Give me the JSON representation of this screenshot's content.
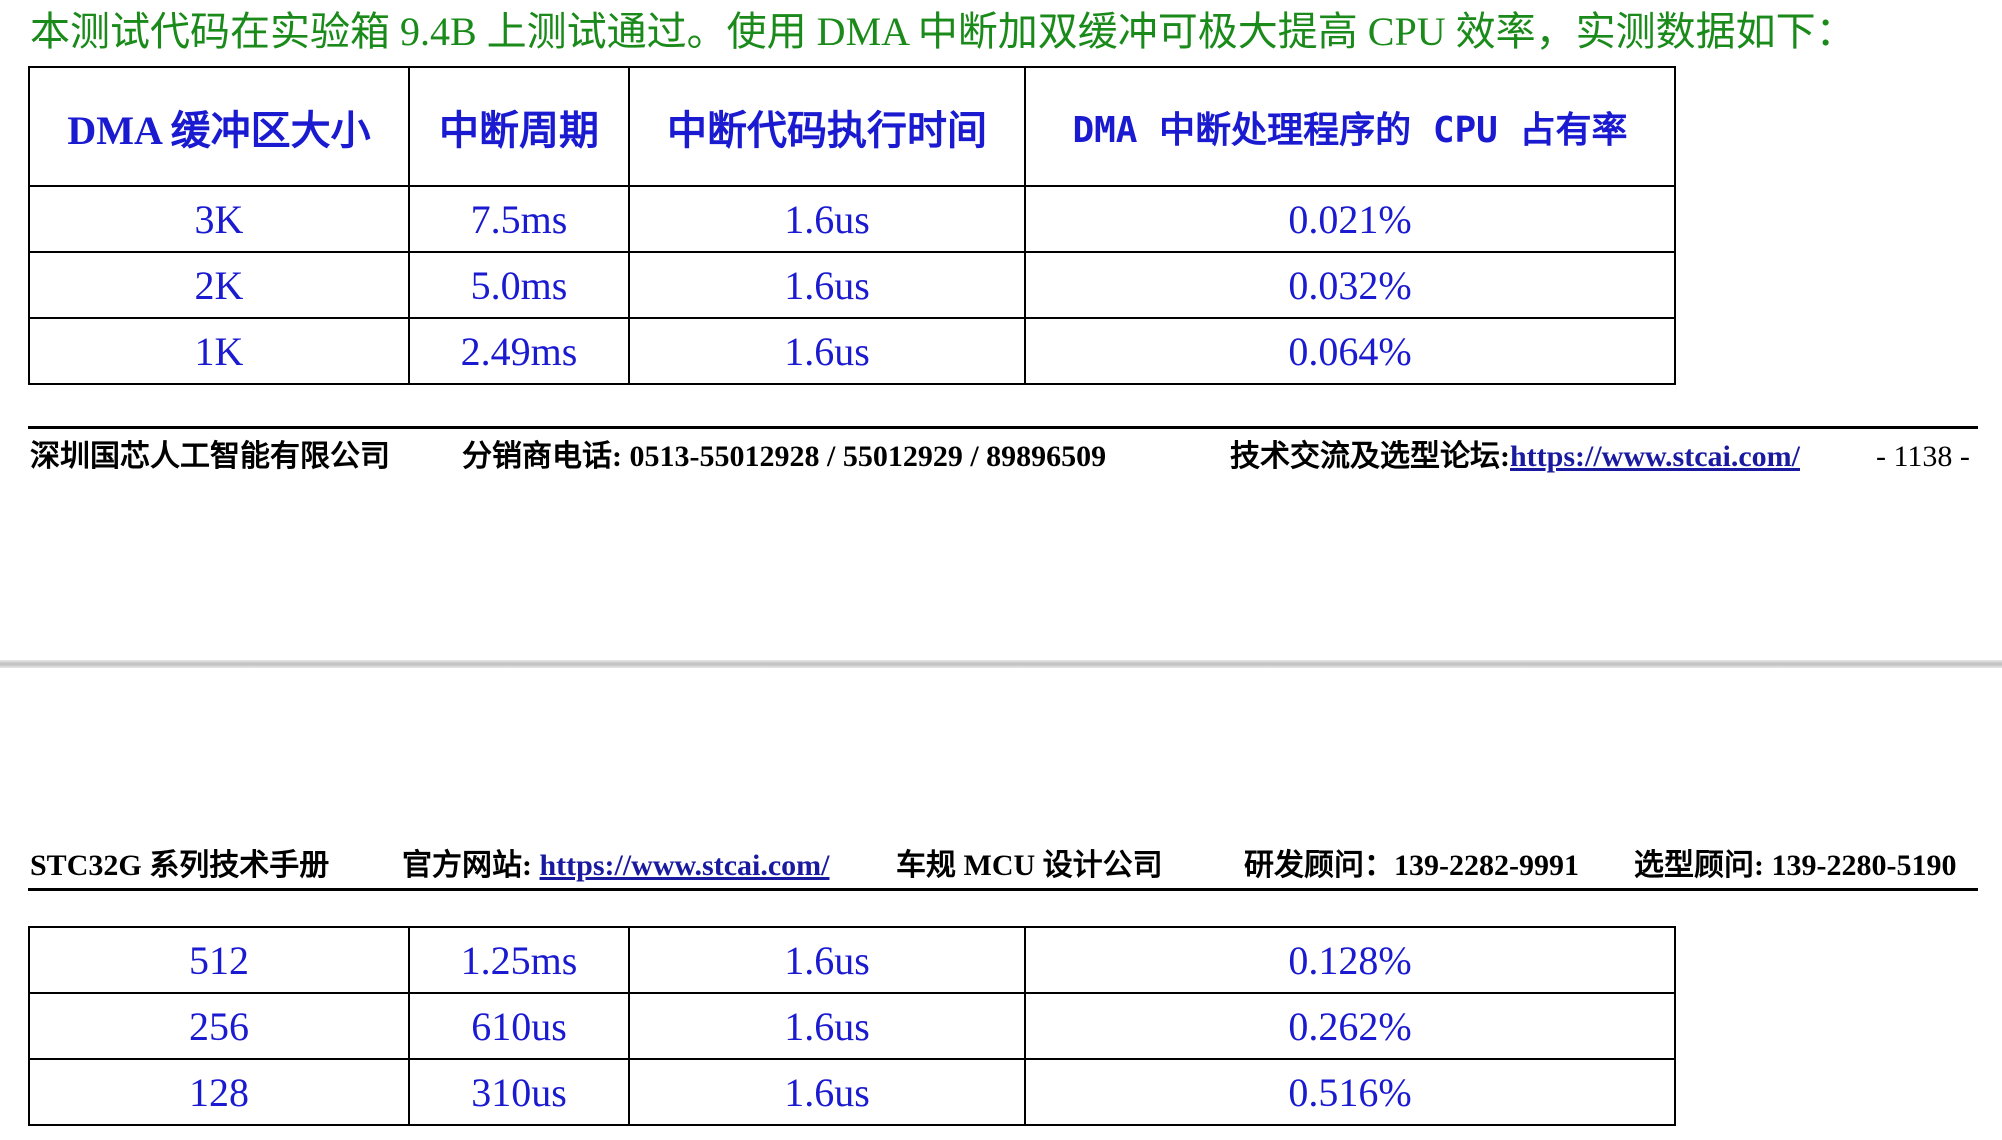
{
  "intro": "本测试代码在实验箱 9.4B 上测试通过。使用 DMA 中断加双缓冲可极大提高 CPU 效率，实测数据如下：",
  "table": {
    "headers": [
      "DMA 缓冲区大小",
      "中断周期",
      "中断代码执行时间",
      "DMA 中断处理程序的 CPU 占有率"
    ],
    "rows_top": [
      [
        "3K",
        "7.5ms",
        "1.6us",
        "0.021%"
      ],
      [
        "2K",
        "5.0ms",
        "1.6us",
        "0.032%"
      ],
      [
        "1K",
        "2.49ms",
        "1.6us",
        "0.064%"
      ]
    ],
    "rows_bottom": [
      [
        "512",
        "1.25ms",
        "1.6us",
        "0.128%"
      ],
      [
        "256",
        "610us",
        "1.6us",
        "0.262%"
      ],
      [
        "128",
        "310us",
        "1.6us",
        "0.516%"
      ]
    ]
  },
  "footer": {
    "company": "深圳国芯人工智能有限公司",
    "distributor_label": "分销商电话: ",
    "distributor_phones": "0513-55012928 / 55012929 / 89896509",
    "forum_label": "技术交流及选型论坛:",
    "forum_url": "https://www.stcai.com/",
    "page_number": "- 1138 -"
  },
  "header": {
    "manual": "STC32G 系列技术手册",
    "site_label": "官方网站: ",
    "site_url": "https://www.stcai.com/",
    "tagline": "车规 MCU 设计公司",
    "rd_label": "研发顾问：",
    "rd_phone": "139-2282-9991",
    "sel_label": "选型顾问: ",
    "sel_phone": "139-2280-5190"
  },
  "colors": {
    "intro_text": "#1a8a1a",
    "table_text": "#1a1ad0",
    "link": "#1a1aa0"
  }
}
